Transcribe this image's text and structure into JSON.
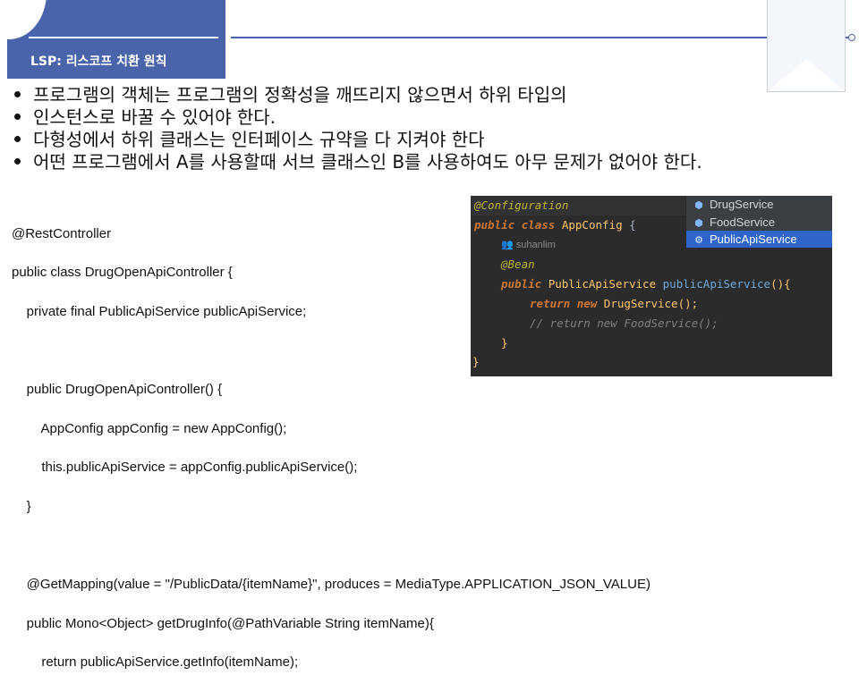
{
  "title": "LSP: 리스코프 치환 원칙",
  "bullets": [
    "프로그램의 객체는 프로그램의 정확성을 깨뜨리지 않으면서 하위 타입의",
    "인스턴스로 바꿀 수 있어야 한다.",
    "다형성에서 하위 클래스는 인터페이스 규약을 다 지켜야 한다",
    "어떤 프로그램에서 A를 사용할때 서브 클래스인 B를 사용하여도 아무 문제가 없어야 한다."
  ],
  "code_left": [
    "@RestController",
    "public class DrugOpenApiController {",
    "    private final PublicApiService publicApiService;",
    "",
    "    public DrugOpenApiController() {",
    "        AppConfig appConfig = new AppConfig();",
    "        this.publicApiService = appConfig.publicApiService();",
    "    }",
    "",
    "    @GetMapping(value = \"/PublicData/{itemName}\", produces = MediaType.APPLICATION_JSON_VALUE)",
    "    public Mono<Object> getDrugInfo(@PathVariable String itemName){",
    "        return publicApiService.getInfo(itemName);"
  ],
  "ide": {
    "annotation_config": "@Configuration",
    "kw_public": "public",
    "kw_class": "class",
    "class_name": "AppConfig",
    "brace_open": "{",
    "author": "suhanlim",
    "annotation_bean": "@Bean",
    "return_type": "PublicApiService",
    "method_name": "publicApiService",
    "method_sig_tail": "(){",
    "kw_return": "return",
    "kw_new": "new",
    "return_class": "DrugService",
    "return_tail": "();",
    "comment_line": "// return new FoodService();",
    "inner_close": "}",
    "outer_close": "}"
  },
  "popup": {
    "items": [
      {
        "label": "DrugService",
        "icon": "interface-icon",
        "selected": false
      },
      {
        "label": "FoodService",
        "icon": "interface-icon",
        "selected": false
      },
      {
        "label": "PublicApiService",
        "icon": "hierarchy-icon",
        "selected": true
      }
    ]
  },
  "colors": {
    "accent": "#4a64ac",
    "ide_background": "#2b2b2b",
    "popup_selection": "#2f65ca"
  }
}
